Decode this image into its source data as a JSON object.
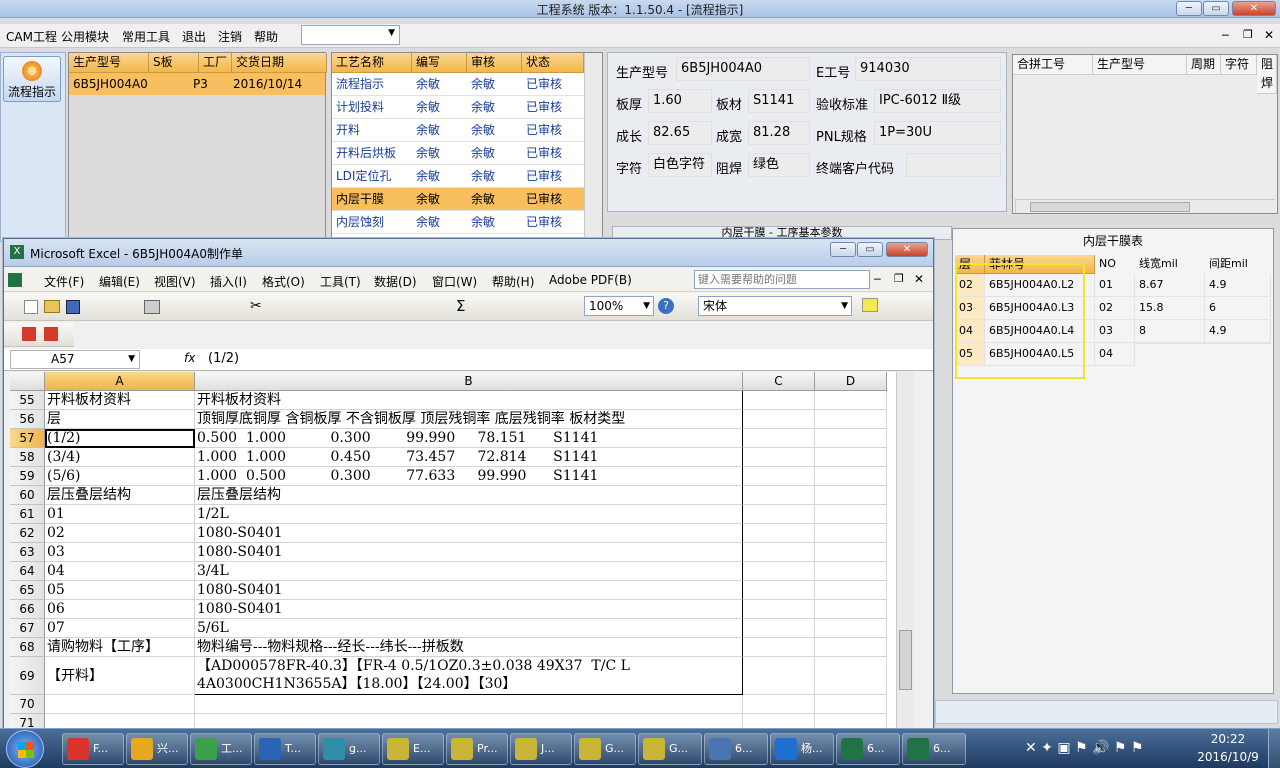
{
  "app": {
    "title": "工程系统  版本：1.1.50.4 - [流程指示]"
  },
  "menu": [
    "CAM工程",
    "公用模块",
    "常用工具",
    "退出",
    "注销",
    "帮助"
  ],
  "left_button": {
    "label": "流程指示"
  },
  "prod_table": {
    "headers": [
      "生产型号",
      "S板",
      "工厂",
      "交货日期"
    ],
    "rows": [
      [
        "6B5JH004A0",
        "",
        "P3",
        "2016/10/14"
      ]
    ]
  },
  "process_table": {
    "headers": [
      "工艺名称",
      "编写",
      "审核",
      "状态"
    ],
    "rows": [
      [
        "流程指示",
        "余敏",
        "余敏",
        "已审核"
      ],
      [
        "计划投料",
        "余敏",
        "余敏",
        "已审核"
      ],
      [
        "开料",
        "余敏",
        "余敏",
        "已审核"
      ],
      [
        "开料后烘板",
        "余敏",
        "余敏",
        "已审核"
      ],
      [
        "LDI定位孔",
        "余敏",
        "余敏",
        "已审核"
      ],
      [
        "内层干膜",
        "余敏",
        "余敏",
        "已审核"
      ],
      [
        "内层蚀刻",
        "余敏",
        "余敏",
        "已审核"
      ]
    ],
    "selected_index": 5
  },
  "info": {
    "prod_model_label": "生产型号",
    "prod_model": "6B5JH004A0",
    "e_no_label": "E工号",
    "e_no": "914030",
    "thickness_label": "板厚",
    "thickness": "1.60",
    "material_label": "板材",
    "material": "S1141",
    "standard_label": "验收标准",
    "standard": "IPC-6012 Ⅱ级",
    "len_label": "成长",
    "len": "82.65",
    "width_label": "成宽",
    "width": "81.28",
    "pnl_label": "PNL规格",
    "pnl": "1P=30U",
    "char_label": "字符",
    "char": "白色字符",
    "mask_label": "阻焊",
    "mask": "绿色",
    "cust_label": "终端客户代码",
    "cust": ""
  },
  "merge_table": {
    "headers": [
      "合拼工号",
      "生产型号",
      "周期",
      "字符",
      "阻焊"
    ]
  },
  "sub_caption": "内层干膜 - 工序基本参数",
  "film_table": {
    "title": "内层干膜表",
    "headers": [
      "层",
      "菲林号",
      "NO",
      "线宽mil",
      "间距mil"
    ],
    "rows": [
      [
        "02",
        "6B5JH004A0.L2",
        "01",
        "8.67",
        "4.9"
      ],
      [
        "03",
        "6B5JH004A0.L3",
        "02",
        "15.8",
        "6"
      ],
      [
        "04",
        "6B5JH004A0.L4",
        "03",
        "8",
        "4.9"
      ],
      [
        "05",
        "6B5JH004A0.L5",
        "04",
        "",
        ""
      ]
    ]
  },
  "excel": {
    "title": "Microsoft Excel - 6B5JH004A0制作单",
    "menu": [
      "文件(F)",
      "编辑(E)",
      "视图(V)",
      "插入(I)",
      "格式(O)",
      "工具(T)",
      "数据(D)",
      "窗口(W)",
      "帮助(H)",
      "Adobe PDF(B)"
    ],
    "help_placeholder": "键入需要帮助的问题",
    "zoom": "100%",
    "font": "宋体",
    "name_box": "A57",
    "formula": "(1/2)",
    "cols": [
      "A",
      "B",
      "C",
      "D"
    ],
    "rows": [
      {
        "n": "55",
        "a": "开料板材资料",
        "b": "开料板材资料"
      },
      {
        "n": "56",
        "a": "层",
        "b": "顶铜厚底铜厚 含铜板厚 不含铜板厚 顶层残铜率 底层残铜率 板材类型"
      },
      {
        "n": "57",
        "a": "(1/2)",
        "b": "0.500  1.000          0.300        99.990     78.151      S1141"
      },
      {
        "n": "58",
        "a": "(3/4)",
        "b": "1.000  1.000          0.450        73.457     72.814      S1141"
      },
      {
        "n": "59",
        "a": "(5/6)",
        "b": "1.000  0.500          0.300        77.633     99.990      S1141"
      },
      {
        "n": "60",
        "a": "层压叠层结构",
        "b": "层压叠层结构"
      },
      {
        "n": "61",
        "a": "01",
        "b": "1/2L"
      },
      {
        "n": "62",
        "a": "02",
        "b": "1080-S0401"
      },
      {
        "n": "63",
        "a": "03",
        "b": "1080-S0401"
      },
      {
        "n": "64",
        "a": "04",
        "b": "3/4L"
      },
      {
        "n": "65",
        "a": "05",
        "b": "1080-S0401"
      },
      {
        "n": "66",
        "a": "06",
        "b": "1080-S0401"
      },
      {
        "n": "67",
        "a": "07",
        "b": "5/6L"
      },
      {
        "n": "68",
        "a": "请购物料【工序】",
        "b": "物料编号---物料规格---经长---纬长---拼板数"
      }
    ],
    "row69": {
      "n": "69",
      "a": "【开料】",
      "b1": "【AD000578FR-40.3】【FR-4 0.5/1OZ0.3±0.038 49X37  T/C L",
      "b2": "4A0300CH1N3655A】【18.00】【24.00】【30】"
    },
    "row70": "70",
    "row71": "71"
  },
  "taskbar": {
    "items": [
      "F...",
      "兴...",
      "工...",
      "T...",
      "g...",
      "E...",
      "Pr...",
      "J...",
      "G...",
      "G...",
      "6...",
      "杨...",
      "6...",
      "6..."
    ],
    "time": "20:22",
    "date": "2016/10/9"
  }
}
